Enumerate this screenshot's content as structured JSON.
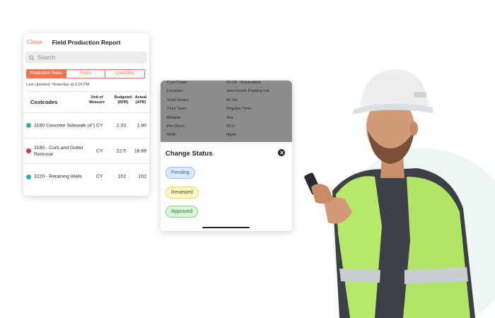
{
  "report": {
    "close_label": "Close",
    "title": "Field Production Report",
    "search_placeholder": "Search",
    "tabs": [
      {
        "label": "Production Rates",
        "active": true
      },
      {
        "label": "Hours",
        "active": false
      },
      {
        "label": "Quantities",
        "active": false
      }
    ],
    "last_updated": "Last Updated: Yesterday at 3:24 PM",
    "columns": {
      "costcode": "Costcodes",
      "unit": "Unit of Measure",
      "budgeted": "Budgeted (BPR)",
      "actual": "Actual (APR)"
    },
    "rows": [
      {
        "status_color": "#2bb5a0",
        "name": "3160 Concrete Sidewalk (4\")",
        "unit": "CY",
        "budgeted": "2.33",
        "actual": "2.80"
      },
      {
        "status_color": "#d7373f",
        "name": "3190 - Curb and Gutter Removal",
        "unit": "CY",
        "budgeted": "22.5",
        "actual": "18.89"
      },
      {
        "status_color": "#2bb5a0",
        "name": "3220 - Retaining Walls",
        "unit": "CY",
        "budgeted": "102",
        "actual": "102"
      }
    ]
  },
  "details": [
    {
      "label": "Cost Code:",
      "value": "01-02 - Excavation"
    },
    {
      "label": "Location:",
      "value": "Site>South Parking Lot"
    },
    {
      "label": "Total Hours:",
      "value": "8h 0m"
    },
    {
      "label": "Time Type:",
      "value": "Regular Time"
    },
    {
      "label": "Billable:",
      "value": "Yes"
    },
    {
      "label": "Per Diem:",
      "value": "30.0"
    },
    {
      "label": "Shift:",
      "value": "Night"
    }
  ],
  "change_status": {
    "title": "Change Status",
    "options": [
      "Pending",
      "Reviewed",
      "Approved"
    ]
  },
  "colors": {
    "accent": "#f0734f",
    "vest": "#b6e86a",
    "hardhat": "#e9eaec",
    "background_circle": "#eef6f4"
  }
}
